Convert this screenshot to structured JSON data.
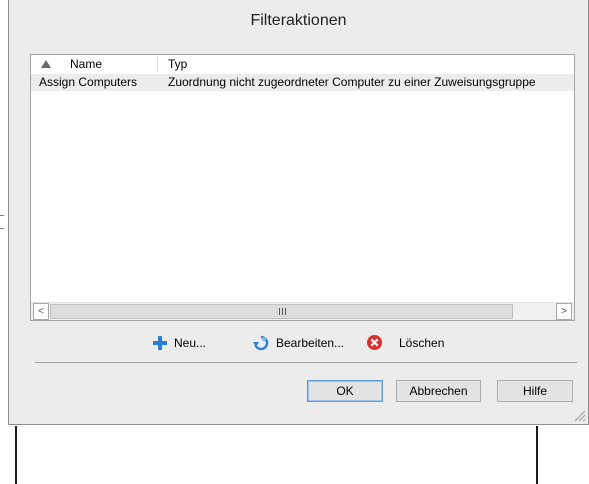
{
  "dialog": {
    "title": "Filteraktionen"
  },
  "listview": {
    "columns": [
      {
        "label": "Name"
      },
      {
        "label": "Typ"
      }
    ],
    "rows": [
      {
        "name": "Assign Computers",
        "typ": "Zuordnung nicht zugeordneter Computer zu einer Zuweisungsgruppe"
      }
    ],
    "scrollbar": {
      "left_arrow": "<",
      "right_arrow": ">"
    }
  },
  "actions": {
    "new_label": "Neu...",
    "edit_label": "Bearbeiten...",
    "delete_label": "Löschen",
    "new_icon": "plus-icon",
    "edit_icon": "refresh-edit-icon",
    "delete_icon": "delete-x-icon"
  },
  "buttons": {
    "ok": "OK",
    "cancel": "Abbrechen",
    "help": "Hilfe"
  },
  "colors": {
    "dialog_bg": "#ececec",
    "default_button_border": "#5a9bd5",
    "plus_icon": "#2a7fd6",
    "delete_icon": "#d9312f"
  }
}
